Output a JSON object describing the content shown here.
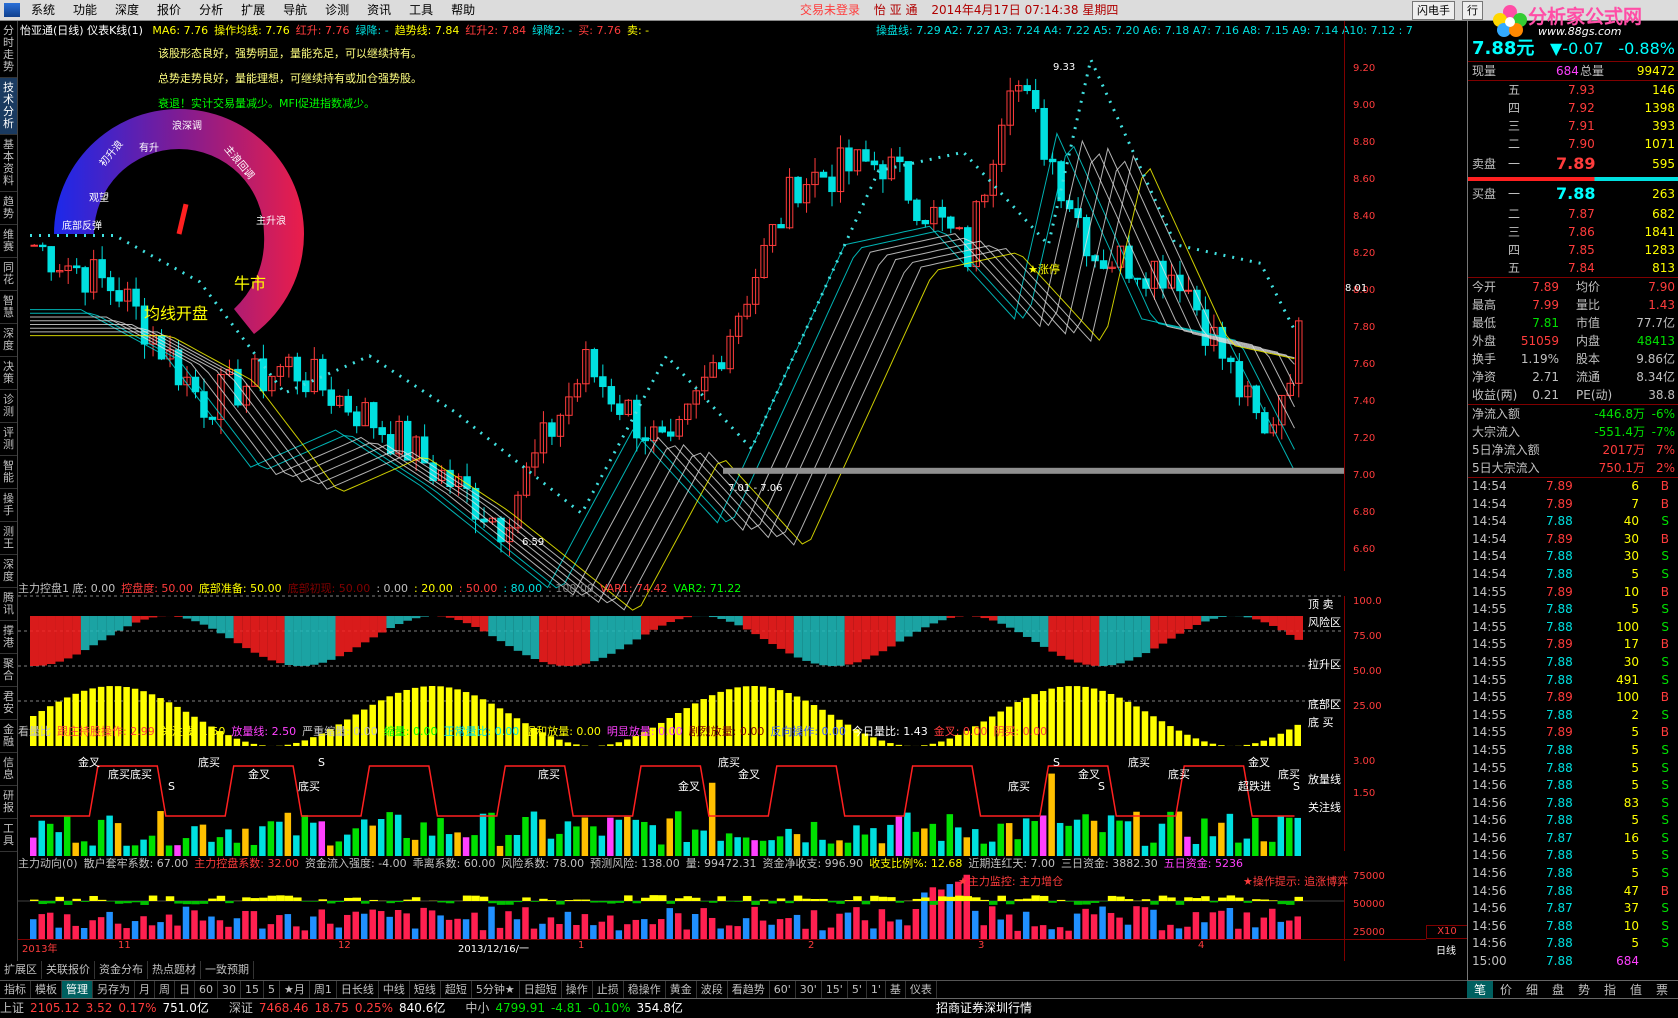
{
  "menu": {
    "items": [
      "系统",
      "功能",
      "深度",
      "报价",
      "分析",
      "扩展",
      "导航",
      "诊测",
      "资讯",
      "工具",
      "帮助"
    ],
    "login_status": "交易未登录",
    "stock_name": "怡 亚 通",
    "date": "2014年4月17日",
    "time": "07:14:38",
    "weekday": "星期四",
    "right_buttons": [
      "闪电手",
      "行"
    ]
  },
  "brand": {
    "title": "分析家公式网",
    "url": "www.88gs.com"
  },
  "left_tabs": [
    "分时走势",
    "技术分析",
    "基本资料",
    "趋势",
    "维赛",
    "同花",
    "智慧",
    "深度",
    "决策",
    "诊测",
    "评测",
    "智能",
    "操手",
    "测王",
    "深度",
    "腾讯",
    "撑港",
    "聚合",
    "君安",
    "金融",
    "信息",
    "研报",
    "工具"
  ],
  "main_legend": {
    "title": "怡亚通(日线) 仪表K线(1)",
    "items": [
      {
        "t": "MA6: 7.76",
        "c": "#ffff00"
      },
      {
        "t": "操作均线: 7.76",
        "c": "#ffff00"
      },
      {
        "t": "红升: 7.76",
        "c": "#ff3c3c"
      },
      {
        "t": "绿降: -",
        "c": "#00e0e0"
      },
      {
        "t": "趋势线: 7.84",
        "c": "#ffff00"
      },
      {
        "t": "红升2: 7.84",
        "c": "#ff3c3c"
      },
      {
        "t": "绿降2: -",
        "c": "#00e0e0"
      },
      {
        "t": "买: 7.76",
        "c": "#ff3c3c"
      },
      {
        "t": "卖: -",
        "c": "#ffff00"
      }
    ],
    "right": "操盘线: 7.29  A2: 7.27  A3: 7.24  A4: 7.22  A5: 7.20  A6: 7.18  A7: 7.16  A8: 7.15  A9: 7.14  A10: 7.12  : 7"
  },
  "commentary": [
    {
      "t": "该股形态良好，强势明显，量能充足，可以继续持有。",
      "c": "#ffff80"
    },
    {
      "t": "总势走势良好，量能理想，可继续持有或加仓强势股。",
      "c": "#ffff80"
    },
    {
      "t": "衰退！实计交易量减少。MFI促进指数减少。",
      "c": "#00ff00"
    }
  ],
  "gauge": {
    "labels": [
      "底部反弹",
      "观望",
      "初升浪",
      "有升",
      "浪深调",
      "主浪回调",
      "主升浪"
    ],
    "mid_text": "均线开盘",
    "mid_text2": "牛市",
    "value_fraction": 0.38
  },
  "price_axis": {
    "ticks": [
      9.2,
      9.0,
      8.8,
      8.6,
      8.4,
      8.2,
      8.0,
      7.8,
      7.6,
      7.4,
      7.2,
      7.0,
      6.8,
      6.6
    ],
    "marker": "8.01",
    "min": 6.5,
    "max": 9.35
  },
  "annotations": {
    "high": "9.33",
    "low": "6.59",
    "band": "7.01 - 7.06",
    "star_label": "★涨停",
    "band_value": 7.03
  },
  "panel2": {
    "legend": [
      {
        "t": "主力控盘1 底: 0.00",
        "c": "#c0c0c0"
      },
      {
        "t": "控盘度: 50.00",
        "c": "#ff3c3c"
      },
      {
        "t": "底部准备: 50.00",
        "c": "#ffff00"
      },
      {
        "t": "底部初现: 50.00",
        "c": "#800000"
      },
      {
        "t": ": 0.00",
        "c": "#c0c0c0"
      },
      {
        "t": ": 20.00",
        "c": "#ffff00"
      },
      {
        "t": ": 50.00",
        "c": "#ff3c3c"
      },
      {
        "t": ": 80.00",
        "c": "#00e0e0"
      },
      {
        "t": ": 100.00",
        "c": "#808080"
      },
      {
        "t": "VAR1: 74.42",
        "c": "#ff3c3c"
      },
      {
        "t": "VAR2: 71.22",
        "c": "#00ff00"
      }
    ],
    "axis": [
      "100.0",
      "75.00",
      "50.00",
      "25.00"
    ],
    "zones": [
      "顶 卖",
      "风险区",
      "拉升区",
      "底部区",
      "底 买"
    ]
  },
  "panel3": {
    "legend": [
      {
        "t": "看量比",
        "c": "#c0c0c0"
      },
      {
        "t": "跟庄持股操作: 2.99",
        "c": "#ff3c3c"
      },
      {
        "t": "关注线: 1.50",
        "c": "#ffff00"
      },
      {
        "t": "放量线: 2.50",
        "c": "#ff40ff"
      },
      {
        "t": "严重缩量: 0.00",
        "c": "#c0c0c0"
      },
      {
        "t": "缩量: 0.00",
        "c": "#00ff00"
      },
      {
        "t": "正常量比: 0.00",
        "c": "#00e0e0"
      },
      {
        "t": "温和放量: 0.00",
        "c": "#ffff00"
      },
      {
        "t": "明显放量: 0.00",
        "c": "#ff40ff"
      },
      {
        "t": "剧烈放量: 0.00",
        "c": "#800000"
      },
      {
        "t": "反向操作: 0.00",
        "c": "#4060ff"
      },
      {
        "t": "今日量比: 1.43",
        "c": "#ffffff"
      },
      {
        "t": "金叉: 0.00",
        "c": "#ff3c3c"
      },
      {
        "t": "阴买: 0.00",
        "c": "#ff3c3c"
      }
    ],
    "axis": [
      "3.00",
      "1.50"
    ],
    "right_labels": [
      "放量线",
      "关注线"
    ],
    "tags": [
      "金叉",
      "底买底买",
      "S",
      "底买",
      "金叉",
      "底买",
      "S",
      "底买",
      "金叉",
      "底买",
      "金叉",
      "底买",
      "S",
      "金叉",
      "S",
      "底买",
      "底买",
      "超跌进",
      "金叉",
      "底买",
      "S"
    ]
  },
  "panel4": {
    "legend": [
      {
        "t": "主力动向(0)",
        "c": "#c0c0c0"
      },
      {
        "t": "散户套牢系数: 67.00",
        "c": "#c0c0c0"
      },
      {
        "t": "主力控盘系数: 32.00",
        "c": "#ff3c3c"
      },
      {
        "t": "资金流入强度: -4.00",
        "c": "#c0c0c0"
      },
      {
        "t": "乖离系数: 60.00",
        "c": "#c0c0c0"
      },
      {
        "t": "风险系数: 78.00",
        "c": "#c0c0c0"
      },
      {
        "t": "预测风险: 138.00",
        "c": "#c0c0c0"
      },
      {
        "t": "量: 99472.31",
        "c": "#c0c0c0"
      },
      {
        "t": "资金净收支: 996.90",
        "c": "#c0c0c0"
      },
      {
        "t": "收支比例%: 12.68",
        "c": "#ffff00"
      },
      {
        "t": "近期连红天: 7.00",
        "c": "#c0c0c0"
      },
      {
        "t": "三日资金: 3882.30",
        "c": "#c0c0c0"
      },
      {
        "t": "五日资金: 5236",
        "c": "#ff40ff"
      }
    ],
    "axis": [
      "75000",
      "50000",
      "25000"
    ],
    "notes": [
      "★主力监控: 主力增仓",
      "★操作提示: 追涨博弈"
    ],
    "corner": "X10"
  },
  "time_axis": {
    "labels": [
      "2013年",
      "11",
      "12",
      "2013/12/16/一",
      "1",
      "2",
      "3",
      "4"
    ],
    "right": "日线"
  },
  "bottom_tabs": [
    "指标",
    "模板",
    "管理",
    "另存为",
    "月",
    "周",
    "日",
    "60",
    "30",
    "15",
    "5",
    "★月",
    "周1",
    "日长线",
    "中线",
    "短线",
    "超短",
    "5分钟★",
    "日超短",
    "操作",
    "止损",
    "稳操作",
    "黄金",
    "波段",
    "看趋势",
    "60'",
    "30'",
    "15'",
    "5'",
    "1'",
    "基",
    "仪表"
  ],
  "bottom_tabs2": [
    "扩展区",
    "关联报价",
    "资金分布",
    "热点题材",
    "一致预期"
  ],
  "quote": {
    "code": "002183",
    "price": "7.88元",
    "change": "▼-0.07",
    "pct": "-0.88%",
    "now_vol_label": "现量",
    "now_vol": "684",
    "total_vol_label": "总量",
    "total_vol": "99472",
    "sell": [
      {
        "n": "五",
        "p": "7.93",
        "v": "146"
      },
      {
        "n": "四",
        "p": "7.92",
        "v": "1398"
      },
      {
        "n": "三",
        "p": "7.91",
        "v": "393"
      },
      {
        "n": "二",
        "p": "7.90",
        "v": "1071"
      },
      {
        "n": "一",
        "p": "7.89",
        "v": "595"
      }
    ],
    "sell_label": "卖盘",
    "buy_label": "买盘",
    "buy": [
      {
        "n": "一",
        "p": "7.88",
        "v": "263"
      },
      {
        "n": "二",
        "p": "7.87",
        "v": "682"
      },
      {
        "n": "三",
        "p": "7.86",
        "v": "1841"
      },
      {
        "n": "四",
        "p": "7.85",
        "v": "1283"
      },
      {
        "n": "五",
        "p": "7.84",
        "v": "813"
      }
    ],
    "stats": [
      {
        "l1": "今开",
        "v1": "7.89",
        "c1": "#ff3c3c",
        "l2": "均价",
        "v2": "7.90",
        "c2": "#ff3c3c"
      },
      {
        "l1": "最高",
        "v1": "7.99",
        "c1": "#ff3c3c",
        "l2": "量比",
        "v2": "1.43",
        "c2": "#ff3c3c"
      },
      {
        "l1": "最低",
        "v1": "7.81",
        "c1": "#00e000",
        "l2": "市值",
        "v2": "77.7亿",
        "c2": "#c0c0c0"
      },
      {
        "l1": "外盘",
        "v1": "51059",
        "c1": "#ff3c3c",
        "l2": "内盘",
        "v2": "48413",
        "c2": "#00e000"
      },
      {
        "l1": "换手",
        "v1": "1.19%",
        "c1": "#c0c0c0",
        "l2": "股本",
        "v2": "9.86亿",
        "c2": "#c0c0c0"
      },
      {
        "l1": "净资",
        "v1": "2.71",
        "c1": "#c0c0c0",
        "l2": "流通",
        "v2": "8.34亿",
        "c2": "#c0c0c0"
      },
      {
        "l1": "收益(两)",
        "v1": "0.21",
        "c1": "#c0c0c0",
        "l2": "PE(动)",
        "v2": "38.8",
        "c2": "#c0c0c0"
      }
    ],
    "flows": [
      {
        "l": "净流入额",
        "v": "-446.8万",
        "p": "-6%",
        "c": "#00e000"
      },
      {
        "l": "大宗流入",
        "v": "-551.4万",
        "p": "-7%",
        "c": "#00e000"
      },
      {
        "l": "5日净流入额",
        "v": "2017万",
        "p": "7%",
        "c": "#ff3c3c"
      },
      {
        "l": "5日大宗流入",
        "v": "750.1万",
        "p": "2%",
        "c": "#ff3c3c"
      }
    ],
    "ticks": [
      {
        "t": "14:54",
        "p": "7.89",
        "v": "6",
        "s": "B"
      },
      {
        "t": "14:54",
        "p": "7.89",
        "v": "7",
        "s": "B"
      },
      {
        "t": "14:54",
        "p": "7.88",
        "v": "40",
        "s": "S"
      },
      {
        "t": "14:54",
        "p": "7.89",
        "v": "30",
        "s": "B"
      },
      {
        "t": "14:54",
        "p": "7.88",
        "v": "30",
        "s": "S"
      },
      {
        "t": "14:54",
        "p": "7.88",
        "v": "5",
        "s": "S"
      },
      {
        "t": "14:55",
        "p": "7.89",
        "v": "10",
        "s": "B"
      },
      {
        "t": "14:55",
        "p": "7.88",
        "v": "5",
        "s": "S"
      },
      {
        "t": "14:55",
        "p": "7.88",
        "v": "100",
        "s": "S"
      },
      {
        "t": "14:55",
        "p": "7.89",
        "v": "17",
        "s": "B"
      },
      {
        "t": "14:55",
        "p": "7.88",
        "v": "30",
        "s": "S"
      },
      {
        "t": "14:55",
        "p": "7.88",
        "v": "491",
        "s": "S"
      },
      {
        "t": "14:55",
        "p": "7.89",
        "v": "100",
        "s": "B"
      },
      {
        "t": "14:55",
        "p": "7.88",
        "v": "2",
        "s": "S"
      },
      {
        "t": "14:55",
        "p": "7.89",
        "v": "5",
        "s": "B"
      },
      {
        "t": "14:55",
        "p": "7.88",
        "v": "5",
        "s": "S"
      },
      {
        "t": "14:55",
        "p": "7.88",
        "v": "5",
        "s": "S"
      },
      {
        "t": "14:56",
        "p": "7.88",
        "v": "5",
        "s": "S"
      },
      {
        "t": "14:56",
        "p": "7.88",
        "v": "83",
        "s": "S"
      },
      {
        "t": "14:56",
        "p": "7.88",
        "v": "5",
        "s": "S"
      },
      {
        "t": "14:56",
        "p": "7.87",
        "v": "16",
        "s": "S"
      },
      {
        "t": "14:56",
        "p": "7.88",
        "v": "5",
        "s": "S"
      },
      {
        "t": "14:56",
        "p": "7.88",
        "v": "5",
        "s": "S"
      },
      {
        "t": "14:56",
        "p": "7.88",
        "v": "47",
        "s": "B"
      },
      {
        "t": "14:56",
        "p": "7.87",
        "v": "37",
        "s": "S"
      },
      {
        "t": "14:56",
        "p": "7.88",
        "v": "10",
        "s": "S"
      },
      {
        "t": "14:56",
        "p": "7.88",
        "v": "5",
        "s": "S"
      },
      {
        "t": "15:00",
        "p": "7.88",
        "v": "684",
        "s": ""
      }
    ],
    "right_tabs": [
      "笔",
      "价",
      "细",
      "盘",
      "势",
      "指",
      "值",
      "票"
    ]
  },
  "status": [
    {
      "l": "上证",
      "v": "2105.12",
      "d": "3.52",
      "p": "0.17%",
      "a": "751.0亿"
    },
    {
      "l": "深证",
      "v": "7468.46",
      "d": "18.75",
      "p": "0.25%",
      "a": "840.6亿"
    },
    {
      "l": "中小",
      "v": "4799.91",
      "d": "-4.81",
      "p": "-0.10%",
      "a": "354.8亿"
    }
  ],
  "broker": "招商证券深圳行情",
  "colors": {
    "up": "#ff3c3c",
    "down": "#00e0e0",
    "bg": "#000000",
    "axis_red": "#800000"
  }
}
